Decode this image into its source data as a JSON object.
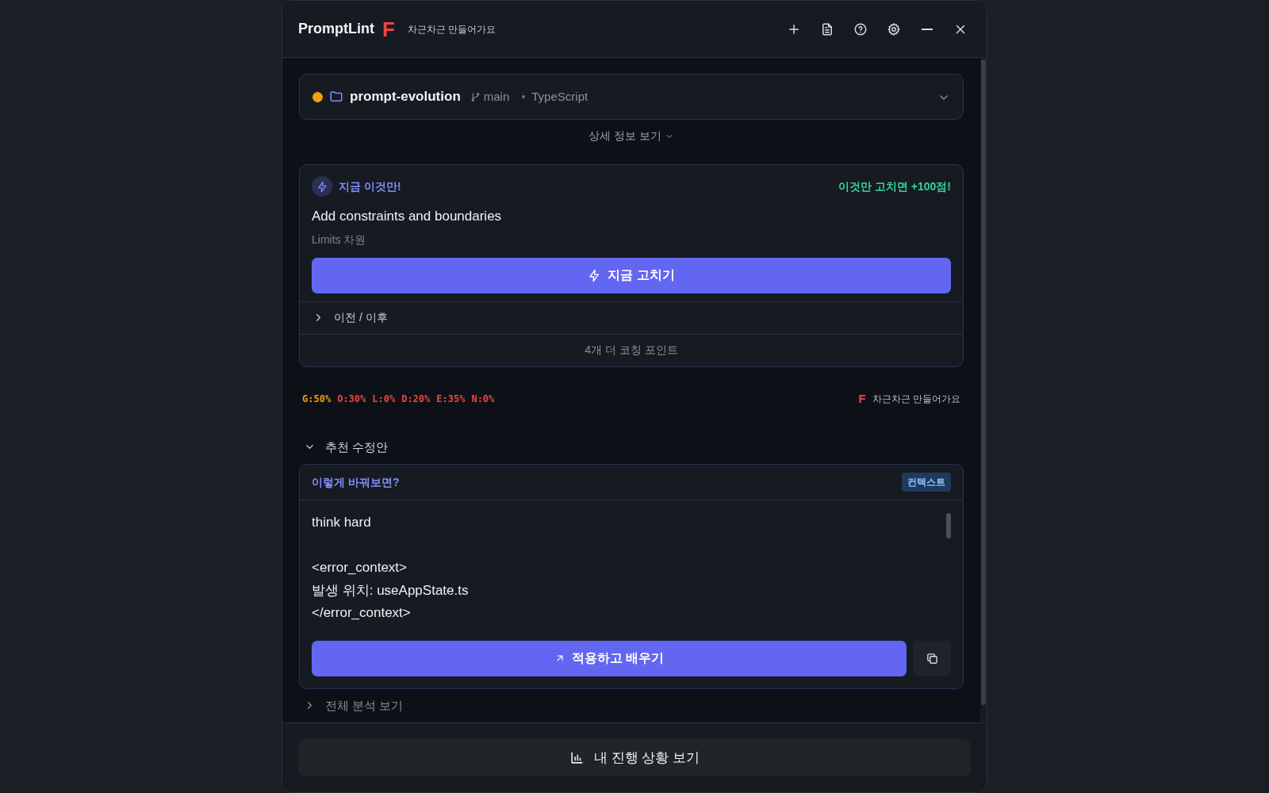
{
  "header": {
    "title": "PromptLint",
    "grade": "F",
    "subtitle": "차근차근 만들어가요"
  },
  "repo": {
    "color": "#f59e0b",
    "name": "prompt-evolution",
    "branch": "main",
    "language": "TypeScript",
    "expanded": false
  },
  "details_link": {
    "label": "상세 정보 보기",
    "expanded": false
  },
  "coaching": {
    "badge": "지금 이것만!",
    "reward": "이것만 고치면 +100점!",
    "title": "Add constraints and boundaries",
    "dimension": "Limits 차원",
    "fix_button": "지금 고치기",
    "before_after": {
      "label": "이전 / 이후",
      "expanded": false
    },
    "more": "4개 더 코칭 포인트"
  },
  "scores": [
    {
      "label": "G:50%",
      "color": "#f59e0b"
    },
    {
      "label": "O:30%",
      "color": "#ef4444"
    },
    {
      "label": "L:0%",
      "color": "#ef4444"
    },
    {
      "label": "D:20%",
      "color": "#ef4444"
    },
    {
      "label": "E:35%",
      "color": "#ef4444"
    },
    {
      "label": "N:0%",
      "color": "#ef4444"
    }
  ],
  "grade_summary": {
    "grade": "F",
    "text": "차근차근 만들어가요"
  },
  "suggestions": {
    "label": "추천 수정안",
    "expanded": true,
    "prompt": "이렇게 바꿔보면?",
    "tag": "컨텍스트",
    "text": "think hard\n\n<error_context>\n발생 위치: useAppState.ts\n</error_context>",
    "apply_button": "적용하고 배우기"
  },
  "full_analysis": {
    "label": "전체 분석 보기",
    "expanded": false
  },
  "footer_button": "내 진행 상황 보기"
}
